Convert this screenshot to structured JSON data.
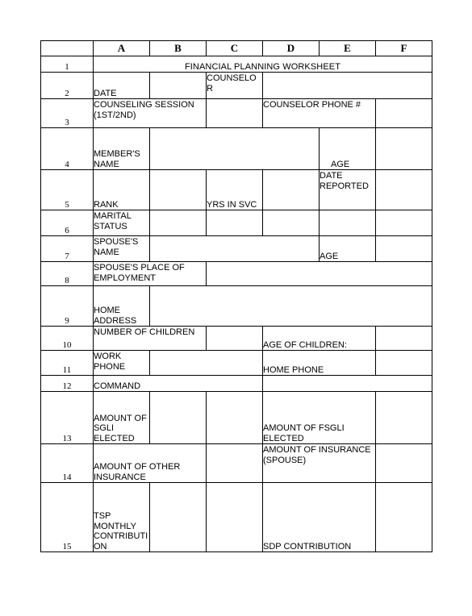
{
  "document": {
    "title": "FINANCIAL PLANNING WORKSHEET",
    "column_headers": [
      "",
      "A",
      "B",
      "C",
      "D",
      "E",
      "F"
    ],
    "row_numbers": [
      "1",
      "2",
      "3",
      "4",
      "5",
      "6",
      "7",
      "8",
      "9",
      "10",
      "11",
      "12",
      "13",
      "14",
      "15"
    ]
  },
  "colheads": {
    "corner": "",
    "a": "A",
    "b": "B",
    "c": "C",
    "d": "D",
    "e": "E",
    "f": "F"
  },
  "rows": {
    "r1": {
      "num": "1",
      "title": "FINANCIAL PLANNING WORKSHEET"
    },
    "r2": {
      "num": "2",
      "a": "DATE",
      "b": "",
      "c": "COUNSELOR",
      "def": ""
    },
    "r3": {
      "num": "3",
      "ab": "COUNSELING SESSION (1ST/2ND)",
      "c": "",
      "de": "COUNSELOR PHONE #",
      "f": ""
    },
    "r4": {
      "num": "4",
      "a": "MEMBER'S NAME",
      "bcd": "",
      "e": "AGE",
      "f": ""
    },
    "r5": {
      "num": "5",
      "a": "RANK",
      "b": "",
      "c": "YRS IN SVC",
      "d": "",
      "e": "DATE REPORTED",
      "f": ""
    },
    "r6": {
      "num": "6",
      "a": "MARITAL STATUS",
      "b": "",
      "c": "",
      "d": "",
      "e": "",
      "f": ""
    },
    "r7": {
      "num": "7",
      "a": "SPOUSE'S NAME",
      "bcd": "",
      "e": "AGE",
      "f": ""
    },
    "r8": {
      "num": "8",
      "ab": "SPOUSE'S PLACE OF EMPLOYMENT",
      "cdef": ""
    },
    "r9": {
      "num": "9",
      "a": "HOME ADDRESS",
      "bcdef": ""
    },
    "r10": {
      "num": "10",
      "ab": "NUMBER OF CHILDREN",
      "c": "",
      "de": "AGE OF CHILDREN:",
      "f": ""
    },
    "r11": {
      "num": "11",
      "a": "WORK PHONE",
      "bc": "",
      "de": "HOME PHONE",
      "f": ""
    },
    "r12": {
      "num": "12",
      "abc": "COMMAND",
      "def": ""
    },
    "r13": {
      "num": "13",
      "a": "AMOUNT OF SGLI ELECTED",
      "b": "",
      "c": "",
      "de": "AMOUNT OF FSGLI ELECTED",
      "f": ""
    },
    "r14": {
      "num": "14",
      "ab": "AMOUNT OF OTHER INSURANCE",
      "c": "",
      "de": "AMOUNT OF INSURANCE (SPOUSE)",
      "f": ""
    },
    "r15": {
      "num": "15",
      "a": "TSP MONTHLY CONTRIBUTION",
      "b": "",
      "c": "",
      "de": "SDP CONTRIBUTION",
      "f": ""
    }
  },
  "colors": {
    "border": "#000000",
    "text": "#000000",
    "background": "#ffffff"
  }
}
